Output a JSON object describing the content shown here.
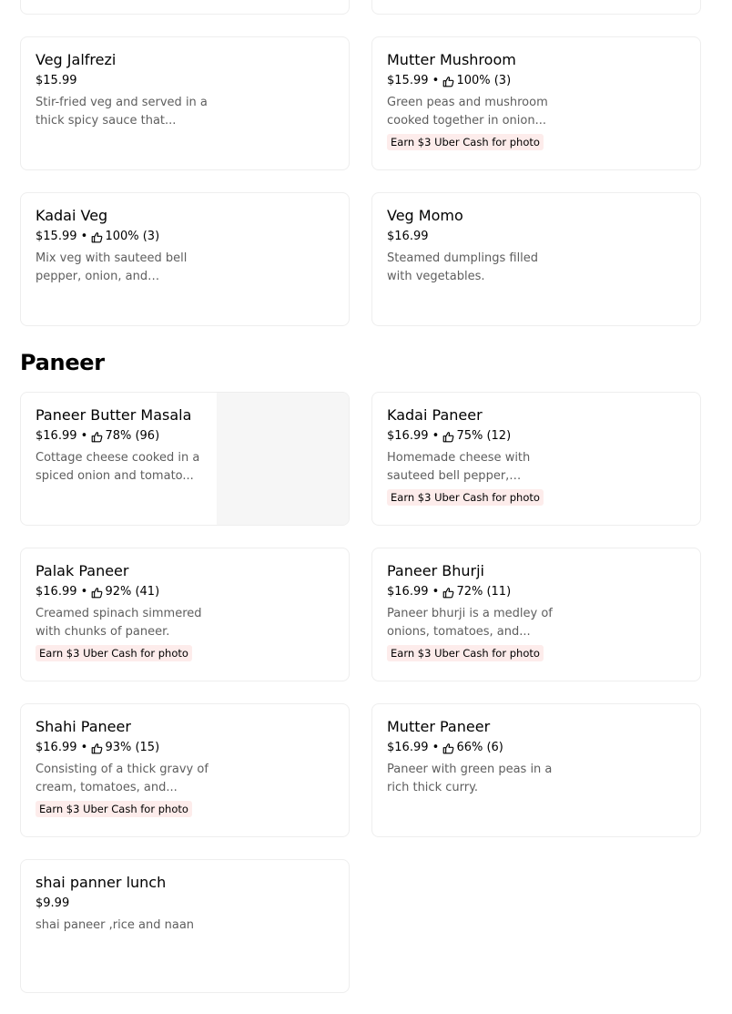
{
  "sections": [
    {
      "title": "",
      "items": [
        {
          "name": "Veg Jalfrezi",
          "price": "$15.99",
          "rating": "",
          "description": "Stir-fried veg and served in a thick spicy sauce that...",
          "promo": ""
        },
        {
          "name": "Mutter Mushroom",
          "price": "$15.99",
          "rating": "100% (3)",
          "description": "Green peas and mushroom cooked together in onion...",
          "promo": "Earn $3 Uber Cash for photo"
        },
        {
          "name": "Kadai Veg",
          "price": "$15.99",
          "rating": "100% (3)",
          "description": "Mix veg with sauteed bell pepper, onion, and tomatoe...",
          "promo": ""
        },
        {
          "name": "Veg Momo",
          "price": "$16.99",
          "rating": "",
          "description": "Steamed dumplings filled with vegetables.",
          "promo": ""
        }
      ]
    },
    {
      "title": "Paneer",
      "items": [
        {
          "name": "Paneer Butter Masala",
          "price": "$16.99",
          "rating": "78% (96)",
          "description": "Cottage cheese cooked in a spiced onion and tomato...",
          "promo": "",
          "has_image": true
        },
        {
          "name": "Kadai Paneer",
          "price": "$16.99",
          "rating": "75% (12)",
          "description": "Homemade cheese with sauteed bell pepper, onion,...",
          "promo": "Earn $3 Uber Cash for photo"
        },
        {
          "name": "Palak Paneer",
          "price": "$16.99",
          "rating": "92% (41)",
          "description": "Creamed spinach simmered with chunks of paneer.",
          "promo": "Earn $3 Uber Cash for photo"
        },
        {
          "name": "Paneer Bhurji",
          "price": "$16.99",
          "rating": "72% (11)",
          "description": "Paneer bhurji is a medley of onions, tomatoes, and...",
          "promo": "Earn $3 Uber Cash for photo"
        },
        {
          "name": "Shahi Paneer",
          "price": "$16.99",
          "rating": "93% (15)",
          "description": "Consisting of a thick gravy of cream, tomatoes, and...",
          "promo": "Earn $3 Uber Cash for photo"
        },
        {
          "name": "Mutter Paneer",
          "price": "$16.99",
          "rating": "66% (6)",
          "description": "Paneer with green peas in a rich thick curry.",
          "promo": ""
        },
        {
          "name": "shai panner lunch",
          "price": "$9.99",
          "rating": "",
          "description": "shai paneer ,rice and naan",
          "promo": ""
        }
      ]
    }
  ],
  "separator": " • ",
  "icons": {
    "rating": "thumbs-up-icon"
  },
  "colors": {
    "promo_bg": "#fdeceb",
    "border": "#eeeeee",
    "muted_text": "#5e5e5e"
  }
}
